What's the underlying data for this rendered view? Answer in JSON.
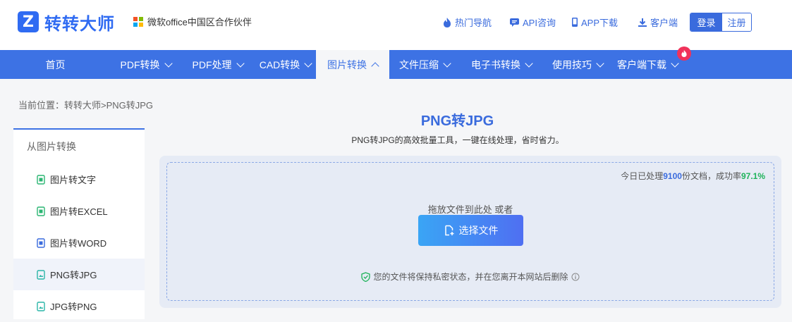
{
  "header": {
    "logo_text": "转转大师",
    "logo_mark": "Z",
    "partner_text": "微软office中国区合作伙伴",
    "links": [
      {
        "label": "热门导航",
        "icon": "fire-icon"
      },
      {
        "label": "API咨询",
        "icon": "chat-icon"
      },
      {
        "label": "APP下载",
        "icon": "phone-icon"
      },
      {
        "label": "客户端",
        "icon": "download-icon"
      }
    ],
    "login_label": "登录",
    "register_label": "注册"
  },
  "nav": {
    "items": [
      {
        "label": "首页",
        "has_dropdown": false
      },
      {
        "label": "PDF转换",
        "has_dropdown": true
      },
      {
        "label": "PDF处理",
        "has_dropdown": true
      },
      {
        "label": "CAD转换",
        "has_dropdown": true
      },
      {
        "label": "图片转换",
        "has_dropdown": true,
        "active": true
      },
      {
        "label": "文件压缩",
        "has_dropdown": true
      },
      {
        "label": "电子书转换",
        "has_dropdown": true
      },
      {
        "label": "使用技巧",
        "has_dropdown": true
      },
      {
        "label": "客户端下载",
        "has_dropdown": true,
        "hot": true
      }
    ]
  },
  "breadcrumb": "当前位置：转转大师>PNG转JPG",
  "sidebar": {
    "heading": "从图片转换",
    "items": [
      {
        "label": "图片转文字",
        "color": "#2bb673"
      },
      {
        "label": "图片转EXCEL",
        "color": "#2bb673"
      },
      {
        "label": "图片转WORD",
        "color": "#3a6bdd"
      },
      {
        "label": "PNG转JPG",
        "color": "#2bb6a8",
        "active": true
      },
      {
        "label": "JPG转PNG",
        "color": "#2bb6a8"
      }
    ]
  },
  "main": {
    "title": "PNG转JPG",
    "subtitle": "PNG转JPG的高效批量工具，一键在线处理，省时省力。",
    "stats_prefix": "今日已处理",
    "stats_count": "9100",
    "stats_mid": "份文档，成功率",
    "stats_rate": "97.1%",
    "drop_hint": "拖放文件到此处 或者",
    "choose_label": "选择文件",
    "privacy_text": "您的文件将保持私密状态，并在您离开本网站后删除"
  },
  "colors": {
    "brand": "#3d72e4",
    "success": "#1fb35a",
    "hot": "#f0325a"
  }
}
